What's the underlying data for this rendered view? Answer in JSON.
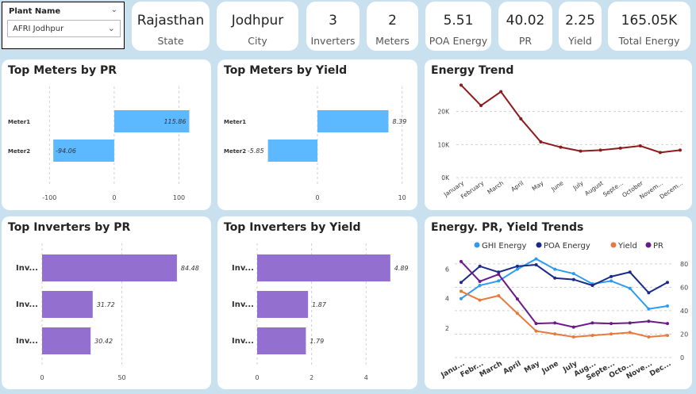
{
  "slicer": {
    "title": "Plant Name",
    "selected": "AFRI Jodhpur"
  },
  "kpis": [
    {
      "value": "Rajasthan",
      "label": "State"
    },
    {
      "value": "Jodhpur",
      "label": "City"
    },
    {
      "value": "3",
      "label": "Inverters"
    },
    {
      "value": "2",
      "label": "Meters"
    },
    {
      "value": "5.51",
      "label": "POA Energy"
    },
    {
      "value": "40.02",
      "label": "PR"
    },
    {
      "value": "2.25",
      "label": "Yield"
    },
    {
      "value": "165.05K",
      "label": "Total Energy"
    }
  ],
  "colors": {
    "meter_bar": "#5cb8ff",
    "inverter_bar": "#9370cf",
    "trend_line": "#8e1b1b",
    "ghi": "#2d9cf0",
    "poa": "#1a2a8a",
    "yield": "#e8793a",
    "pr": "#6b1a8a"
  },
  "chart_data": [
    {
      "type": "bar",
      "orientation": "horizontal",
      "title": "Top Meters by PR",
      "categories": [
        "Meter1",
        "Meter2"
      ],
      "values": [
        115.86,
        -94.06
      ],
      "value_labels": [
        "115.86",
        "-94.06"
      ],
      "xlim": [
        -120,
        130
      ],
      "xticks": [
        -100,
        0,
        100
      ],
      "grid": true
    },
    {
      "type": "bar",
      "orientation": "horizontal",
      "title": "Top Meters by Yield",
      "categories": [
        "Meter1",
        "Meter2"
      ],
      "values": [
        8.39,
        -5.85
      ],
      "value_labels": [
        "8.39",
        "-5.85"
      ],
      "xlim": [
        -7.5,
        10.5
      ],
      "xticks": [
        0,
        10
      ],
      "grid": true
    },
    {
      "type": "line",
      "title": "Energy Trend",
      "categories": [
        "January",
        "February",
        "March",
        "April",
        "May",
        "June",
        "July",
        "August",
        "Septe...",
        "October",
        "Novem...",
        "Decem..."
      ],
      "values": [
        28000,
        21800,
        26000,
        17800,
        10800,
        9200,
        8000,
        8300,
        8900,
        9600,
        7600,
        8300
      ],
      "ylim": [
        0,
        30000
      ],
      "yticks": [
        0,
        10000,
        20000
      ],
      "ytick_labels": [
        "0K",
        "10K",
        "20K"
      ],
      "grid": true
    },
    {
      "type": "bar",
      "orientation": "horizontal",
      "title": "Top Inverters by PR",
      "categories": [
        "Inv...",
        "Inv...",
        "Inv..."
      ],
      "values": [
        84.48,
        31.72,
        30.42
      ],
      "value_labels": [
        "84.48",
        "31.72",
        "30.42"
      ],
      "xlim": [
        0,
        88
      ],
      "xticks": [
        0,
        50
      ],
      "grid": true
    },
    {
      "type": "bar",
      "orientation": "horizontal",
      "title": "Top Inverters by Yield",
      "categories": [
        "Inv...",
        "Inv...",
        "Inv..."
      ],
      "values": [
        4.89,
        1.87,
        1.79
      ],
      "value_labels": [
        "4.89",
        "1.87",
        "1.79"
      ],
      "xlim": [
        0,
        5.1
      ],
      "xticks": [
        0,
        2,
        4
      ],
      "grid": true
    },
    {
      "type": "line",
      "title": "Energy. PR, Yield Trends",
      "categories": [
        "Janu...",
        "Febr...",
        "March",
        "April",
        "May",
        "June",
        "July",
        "Aug...",
        "Septe...",
        "Octo...",
        "Nove...",
        "Dec..."
      ],
      "ylim_left": [
        0,
        7
      ],
      "yticks_left": [
        2,
        4,
        6
      ],
      "ylim_right": [
        0,
        88
      ],
      "yticks_right": [
        0,
        20,
        40,
        60,
        80
      ],
      "legend_position": "top",
      "series": [
        {
          "name": "GHI Energy",
          "axis": "left",
          "values": [
            4.0,
            4.9,
            5.2,
            6.0,
            6.7,
            6.0,
            5.7,
            5.0,
            5.2,
            4.7,
            3.3,
            3.5
          ]
        },
        {
          "name": "POA Energy",
          "axis": "left",
          "values": [
            5.1,
            6.2,
            5.8,
            6.2,
            6.3,
            5.4,
            5.3,
            4.9,
            5.5,
            5.8,
            4.4,
            5.1
          ]
        },
        {
          "name": "Yield",
          "axis": "left",
          "values": [
            4.5,
            3.9,
            4.2,
            3.0,
            1.8,
            1.6,
            1.4,
            1.5,
            1.6,
            1.7,
            1.4,
            1.5
          ]
        },
        {
          "name": "PR",
          "axis": "right",
          "values": [
            82,
            65,
            71,
            50,
            29,
            29.5,
            26,
            29.5,
            29,
            29.5,
            31,
            29
          ]
        }
      ]
    }
  ]
}
